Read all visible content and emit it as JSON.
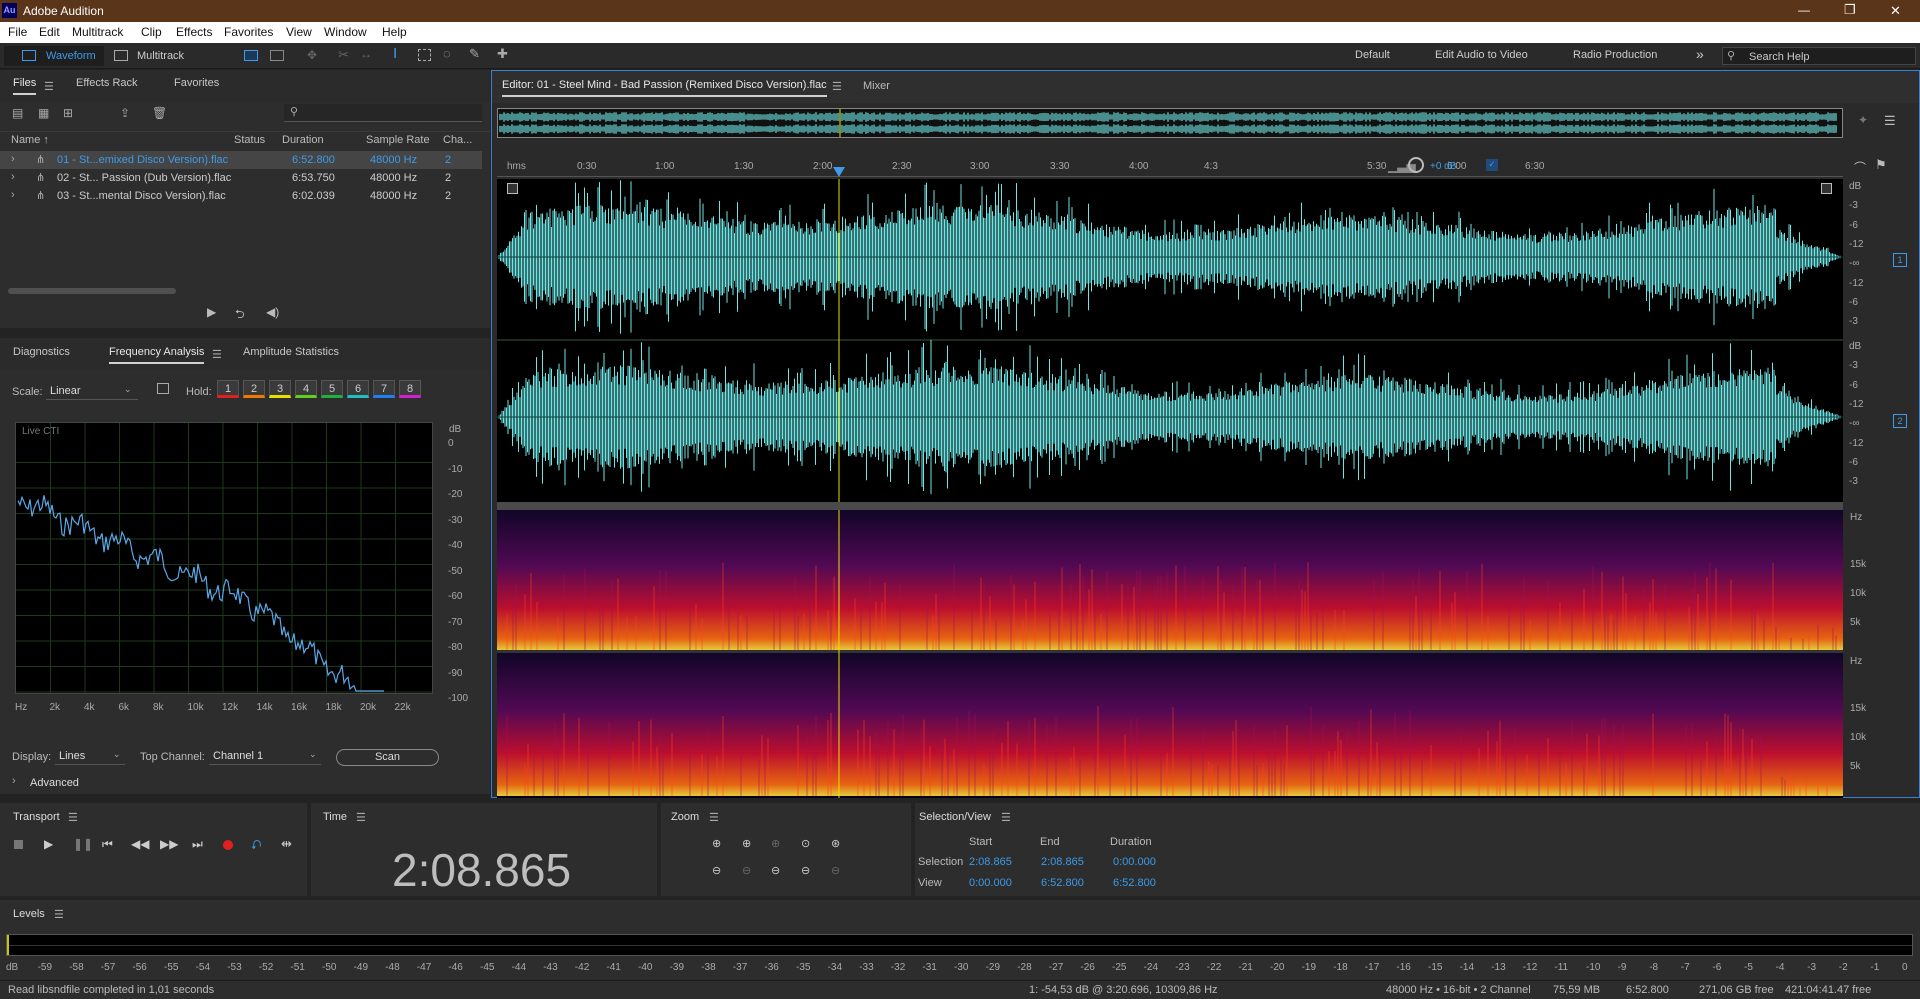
{
  "app": {
    "icon_text": "Au",
    "title": "Adobe Audition"
  },
  "window_controls": {
    "minimize": "—",
    "restore": "❐",
    "close": "✕"
  },
  "menu": [
    "File",
    "Edit",
    "Multitrack",
    "Clip",
    "Effects",
    "Favorites",
    "View",
    "Window",
    "Help"
  ],
  "toolbar": {
    "waveform": "Waveform",
    "multitrack": "Multitrack",
    "workspaces": [
      "Default",
      "Edit Audio to Video",
      "Radio Production"
    ],
    "more": "»",
    "search_placeholder": "Search Help"
  },
  "files_panel": {
    "tabs": [
      "Files",
      "Effects Rack",
      "Favorites"
    ],
    "columns": [
      "Name ↑",
      "Status",
      "Duration",
      "Sample Rate",
      "Cha..."
    ],
    "rows": [
      {
        "name": "01 - St...emixed Disco Version).flac",
        "duration": "6:52.800",
        "rate": "48000 Hz",
        "ch": "2",
        "selected": true
      },
      {
        "name": "02 - St... Passion (Dub Version).flac",
        "duration": "6:53.750",
        "rate": "48000 Hz",
        "ch": "2",
        "selected": false
      },
      {
        "name": "03 - St...mental Disco Version).flac",
        "duration": "6:02.039",
        "rate": "48000 Hz",
        "ch": "2",
        "selected": false
      }
    ]
  },
  "analysis_panel": {
    "tabs": [
      "Diagnostics",
      "Frequency Analysis",
      "Amplitude Statistics"
    ],
    "scale_label": "Scale:",
    "scale_value": "Linear",
    "hold_label": "Hold:",
    "hold": [
      {
        "n": "1",
        "color": "#e02020"
      },
      {
        "n": "2",
        "color": "#f07800"
      },
      {
        "n": "3",
        "color": "#e8e000"
      },
      {
        "n": "4",
        "color": "#60d020"
      },
      {
        "n": "5",
        "color": "#20b040"
      },
      {
        "n": "6",
        "color": "#20c0c0"
      },
      {
        "n": "7",
        "color": "#2080f0"
      },
      {
        "n": "8",
        "color": "#d020d0"
      }
    ],
    "graph_label": "Live CTI",
    "db_ticks": [
      "dB",
      "0",
      "-10",
      "-20",
      "-30",
      "-40",
      "-50",
      "-60",
      "-70",
      "-80",
      "-90",
      "-100"
    ],
    "hz_ticks": [
      "Hz",
      "2k",
      "4k",
      "6k",
      "8k",
      "10k",
      "12k",
      "14k",
      "16k",
      "18k",
      "20k",
      "22k"
    ],
    "display_label": "Display:",
    "display_value": "Lines",
    "channel_label": "Top Channel:",
    "channel_value": "Channel 1",
    "scan": "Scan",
    "advanced": "Advanced"
  },
  "editor": {
    "tab": "Editor: 01 - Steel Mind - Bad Passion (Remixed Disco Version).flac",
    "mixer": "Mixer",
    "timeline": [
      "hms",
      "0:30",
      "1:00",
      "1:30",
      "2:00",
      "2:30",
      "3:00",
      "3:30",
      "4:00",
      "4:3",
      "5:30",
      "6:00",
      "6:30"
    ],
    "gain": "+0 dB",
    "ch1_db": [
      "dB",
      "-3",
      "-6",
      "-12",
      "-∞",
      "-12",
      "-6",
      "-3"
    ],
    "ch2_db": [
      "dB",
      "-3",
      "-6",
      "-12",
      "-∞",
      "-12",
      "-6",
      "-3"
    ],
    "ch1_num": "1",
    "ch2_num": "2",
    "spec_hz": [
      "Hz",
      "15k",
      "10k",
      "5k"
    ]
  },
  "transport": {
    "title": "Transport"
  },
  "time": {
    "title": "Time",
    "value": "2:08.865"
  },
  "zoom": {
    "title": "Zoom"
  },
  "selection": {
    "title": "Selection/View",
    "headers": [
      "Start",
      "End",
      "Duration"
    ],
    "rows": [
      {
        "label": "Selection",
        "start": "2:08.865",
        "end": "2:08.865",
        "duration": "0:00.000"
      },
      {
        "label": "View",
        "start": "0:00.000",
        "end": "6:52.800",
        "duration": "6:52.800"
      }
    ]
  },
  "levels": {
    "title": "Levels",
    "ticks": [
      "dB",
      "-59",
      "-58",
      "-57",
      "-56",
      "-55",
      "-54",
      "-53",
      "-52",
      "-51",
      "-50",
      "-49",
      "-48",
      "-47",
      "-46",
      "-45",
      "-44",
      "-43",
      "-42",
      "-41",
      "-40",
      "-39",
      "-38",
      "-37",
      "-36",
      "-35",
      "-34",
      "-33",
      "-32",
      "-31",
      "-30",
      "-29",
      "-28",
      "-27",
      "-26",
      "-25",
      "-24",
      "-23",
      "-22",
      "-21",
      "-20",
      "-19",
      "-18",
      "-17",
      "-16",
      "-15",
      "-14",
      "-13",
      "-12",
      "-11",
      "-10",
      "-9",
      "-8",
      "-7",
      "-6",
      "-5",
      "-4",
      "-3",
      "-2",
      "-1",
      "0"
    ]
  },
  "status": {
    "left": "Read libsndfile completed in 1,01 seconds",
    "cursor": "1: -54,53 dB @ 3:20.696, 10309,86 Hz",
    "format": "48000 Hz • 16-bit • 2 Channel",
    "size": "75,59 MB",
    "duration": "6:52.800",
    "free": "271,06 GB free",
    "free_time": "421:04:41.47 free"
  }
}
